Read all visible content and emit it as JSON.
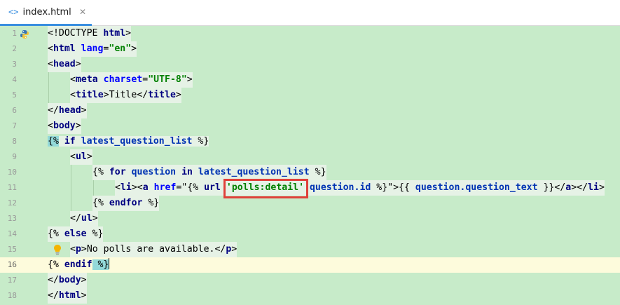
{
  "tab": {
    "icon": "<>",
    "title": "index.html",
    "close": "✕"
  },
  "editor": {
    "current_line": 16,
    "line_numbers": [
      "1",
      "2",
      "3",
      "4",
      "5",
      "6",
      "7",
      "8",
      "9",
      "10",
      "11",
      "12",
      "13",
      "14",
      "15",
      "16",
      "17",
      "18"
    ],
    "lines": {
      "l1": {
        "a": "<!DOCTYPE ",
        "b": "html",
        "c": ">"
      },
      "l2": {
        "a": "<",
        "b": "html ",
        "c": "lang",
        "d": "=",
        "e": "\"en\"",
        "f": ">"
      },
      "l3": {
        "a": "<",
        "b": "head",
        "c": ">"
      },
      "l4": {
        "a": "<",
        "b": "meta ",
        "c": "charset",
        "d": "=",
        "e": "\"UTF-8\"",
        "f": ">"
      },
      "l5": {
        "a": "<",
        "b": "title",
        "c": ">",
        "d": "Title",
        "e": "</",
        "f": "title",
        "g": ">"
      },
      "l6": {
        "a": "</",
        "b": "head",
        "c": ">"
      },
      "l7": {
        "a": "<",
        "b": "body",
        "c": ">"
      },
      "l8": {
        "a": "{%",
        "b": " if ",
        "c": "latest_question_list",
        "d": " %}"
      },
      "l9": {
        "a": "<",
        "b": "ul",
        "c": ">"
      },
      "l10": {
        "a": "{% ",
        "b": "for ",
        "c": "question ",
        "d": "in ",
        "e": "latest_question_list",
        "f": " %}"
      },
      "l11": {
        "a": "<",
        "b": "li",
        "c": "><",
        "d": "a ",
        "e": "href",
        "f": "=\"",
        "g": "{% ",
        "h": "url ",
        "i": "'polls:detail'",
        "j": " ",
        "k": "question.id",
        "l": " %}",
        "m": "\">",
        "n": "{{ ",
        "o": "question.question_text",
        "p": " }}",
        "q": "</",
        "r": "a",
        "s": "></",
        "t": "li",
        "u": ">"
      },
      "l12": {
        "a": "{% ",
        "b": "endfor",
        "c": " %}"
      },
      "l13": {
        "a": "</",
        "b": "ul",
        "c": ">"
      },
      "l14": {
        "a": "{% ",
        "b": "else",
        "c": " %}"
      },
      "l15": {
        "a": "<",
        "b": "p",
        "c": ">",
        "d": "No polls are available.",
        "e": "</",
        "f": "p",
        "g": ">"
      },
      "l16": {
        "a": "{% ",
        "b": "endif",
        "c": " %}"
      },
      "l17": {
        "a": "</",
        "b": "body",
        "c": ">"
      },
      "l18": {
        "a": "</",
        "b": "html",
        "c": ">"
      }
    }
  },
  "colors": {
    "editor_bg": "#c7ebc9",
    "current_line_bg": "#fdfbdc",
    "highlight_box": "#e0403a",
    "tab_underline": "#3a8fe0"
  },
  "icons": {
    "gutter_line1": "python-icon",
    "gutter_line15": "lightbulb-icon"
  }
}
